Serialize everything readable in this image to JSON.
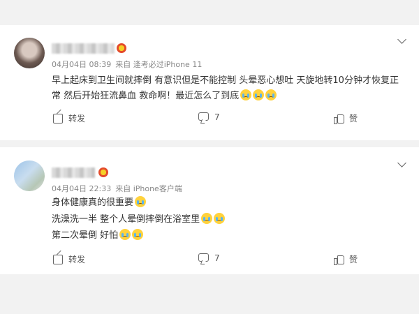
{
  "comments": [
    {
      "timestamp": "04月04日 08:39",
      "source": "来自 逢考必过iPhone 11",
      "lines": [
        "早上起床到卫生间就摔倒 有意识但是不能控制 头晕恶心想吐 天旋地转10分钟才恢复正",
        "常 然后开始狂流鼻血 救命啊！最近怎么了到底"
      ],
      "repost_label": "转发",
      "comment_count": "7",
      "like_label": "赞"
    },
    {
      "timestamp": "04月04日 22:33",
      "source": "来自 iPhone客户端",
      "lines": [
        "身体健康真的很重要",
        "洗澡洗一半 整个人晕倒摔倒在浴室里",
        "第二次晕倒 好怕"
      ],
      "repost_label": "转发",
      "comment_count": "7",
      "like_label": "赞"
    }
  ]
}
